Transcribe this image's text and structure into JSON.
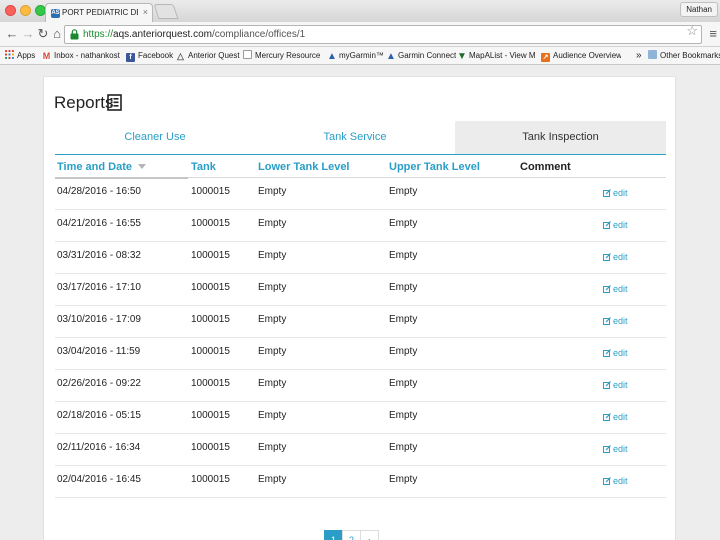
{
  "browser": {
    "tab_title": "PORT PEDIATRIC DENTIST",
    "tab_favicon": "AS",
    "tab_close": "×",
    "user": "Nathan",
    "url_scheme": "https://",
    "url_host": "aqs.anteriorquest.com",
    "url_path": "/compliance/offices/1",
    "bookmarks": [
      {
        "label": "Apps",
        "icon": "apps-grid-icon",
        "color": "#d0453a"
      },
      {
        "label": "Inbox - nathankoster",
        "icon": "gmail-icon",
        "color": "#d44638"
      },
      {
        "label": "Facebook",
        "icon": "facebook-icon",
        "color": "#3b5998"
      },
      {
        "label": "Anterior Quest",
        "icon": "triangle-icon",
        "color": "#777777"
      },
      {
        "label": "Mercury Resource Li",
        "icon": "page-icon",
        "color": "#999999"
      },
      {
        "label": "myGarmin™",
        "icon": "garmin-icon",
        "color": "#2a62ab"
      },
      {
        "label": "Garmin Connect",
        "icon": "garmin-icon",
        "color": "#2a62ab"
      },
      {
        "label": "MapAList - View Ma",
        "icon": "mapalist-icon",
        "color": "#1b6d2a"
      },
      {
        "label": "Audience Overview",
        "icon": "analytics-icon",
        "color": "#e8711a"
      }
    ],
    "bookmarks_overflow": "»",
    "other_bookmarks": "Other Bookmarks"
  },
  "page": {
    "title": "Reports",
    "title_icon": "list-icon",
    "tabs": [
      "Cleaner Use",
      "Tank Service",
      "Tank Inspection"
    ],
    "active_tab": "Tank Inspection",
    "columns": {
      "time": "Time and Date",
      "tank": "Tank",
      "lower": "Lower Tank Level",
      "upper": "Upper Tank Level",
      "comment": "Comment"
    },
    "edit_label": "edit",
    "rows": [
      {
        "time": "04/28/2016 - 16:50",
        "tank": "1000015",
        "lower": "Empty",
        "upper": "Empty",
        "comment": ""
      },
      {
        "time": "04/21/2016 - 16:55",
        "tank": "1000015",
        "lower": "Empty",
        "upper": "Empty",
        "comment": ""
      },
      {
        "time": "03/31/2016 - 08:32",
        "tank": "1000015",
        "lower": "Empty",
        "upper": "Empty",
        "comment": ""
      },
      {
        "time": "03/17/2016 - 17:10",
        "tank": "1000015",
        "lower": "Empty",
        "upper": "Empty",
        "comment": ""
      },
      {
        "time": "03/10/2016 - 17:09",
        "tank": "1000015",
        "lower": "Empty",
        "upper": "Empty",
        "comment": ""
      },
      {
        "time": "03/04/2016 - 11:59",
        "tank": "1000015",
        "lower": "Empty",
        "upper": "Empty",
        "comment": ""
      },
      {
        "time": "02/26/2016 - 09:22",
        "tank": "1000015",
        "lower": "Empty",
        "upper": "Empty",
        "comment": ""
      },
      {
        "time": "02/18/2016 - 05:15",
        "tank": "1000015",
        "lower": "Empty",
        "upper": "Empty",
        "comment": ""
      },
      {
        "time": "02/11/2016 - 16:34",
        "tank": "1000015",
        "lower": "Empty",
        "upper": "Empty",
        "comment": ""
      },
      {
        "time": "02/04/2016 - 16:45",
        "tank": "1000015",
        "lower": "Empty",
        "upper": "Empty",
        "comment": ""
      }
    ],
    "pager": [
      "1",
      "2",
      "›"
    ]
  },
  "colors": {
    "accent": "#2a9ec6",
    "active_tab_bg": "#ececec",
    "secure_green": "#1b8a2f"
  }
}
